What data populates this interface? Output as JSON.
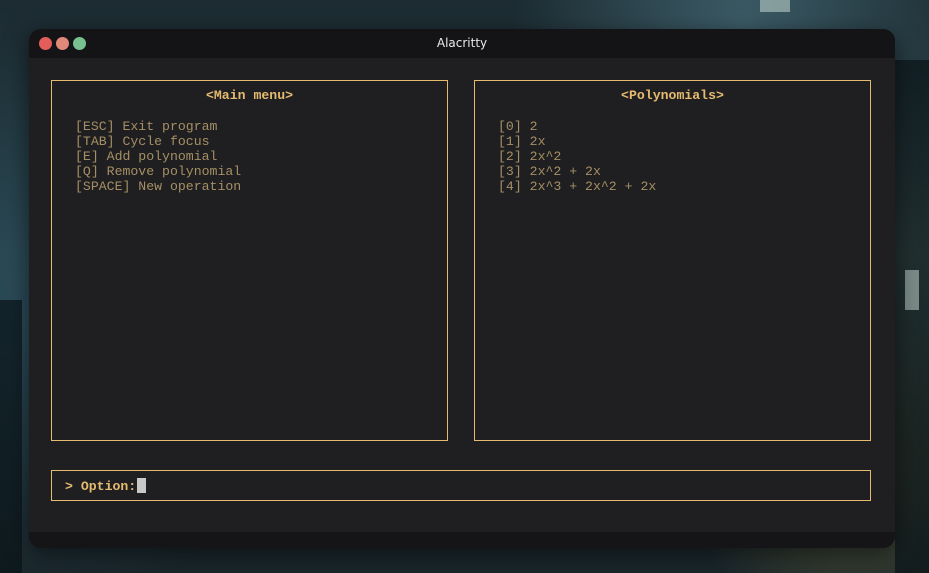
{
  "window": {
    "title": "Alacritty"
  },
  "colors": {
    "accent": "#e4bb6f",
    "text_dim": "#a58f64",
    "terminal_bg": "#1f1f21",
    "titlebar_bg": "#141416",
    "close": "#e35e5b",
    "minimize": "#e0897a",
    "maximize": "#78c08f",
    "cursor": "#c8c8c8"
  },
  "main_menu": {
    "title": "<Main menu>",
    "items": [
      "[ESC] Exit program",
      "[TAB] Cycle focus",
      "[E] Add polynomial",
      "[Q] Remove polynomial",
      "[SPACE] New operation"
    ]
  },
  "polynomials": {
    "title": "<Polynomials>",
    "items": [
      "[0] 2",
      "[1] 2x",
      "[2] 2x^2",
      "[3] 2x^2 + 2x",
      "[4] 2x^3 + 2x^2 + 2x"
    ]
  },
  "input": {
    "prompt": "> Option:"
  },
  "icons": {
    "close": "close-circle-icon",
    "minimize": "minimize-circle-icon",
    "maximize": "maximize-circle-icon"
  }
}
